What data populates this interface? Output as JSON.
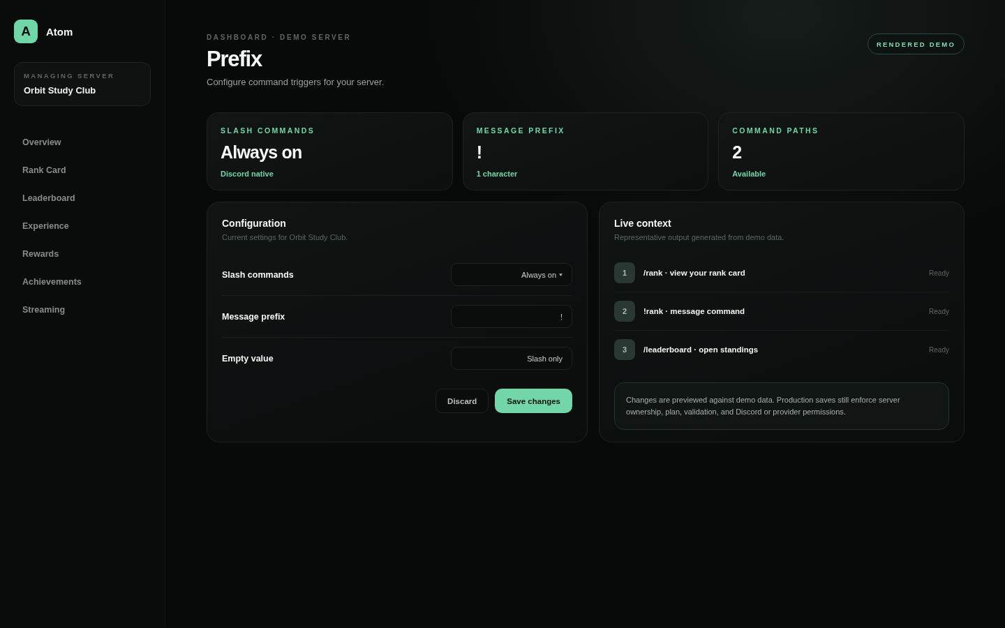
{
  "sidebar": {
    "logo": {
      "letter": "A",
      "name": "Atom"
    },
    "server_card": {
      "label": "MANAGING SERVER",
      "name": "Orbit Study Club"
    },
    "items": [
      {
        "label": "Overview",
        "selected": false
      },
      {
        "label": "Rank Card",
        "selected": false
      },
      {
        "label": "Leaderboard",
        "selected": false
      },
      {
        "label": "Experience",
        "selected": false
      },
      {
        "label": "Rewards",
        "selected": false
      },
      {
        "label": "Achievements",
        "selected": false
      },
      {
        "label": "Streaming",
        "selected": false
      }
    ]
  },
  "header": {
    "breadcrumb": "DASHBOARD · DEMO SERVER",
    "title": "Prefix",
    "subtitle": "Configure command triggers for your server.",
    "badge": "RENDERED DEMO"
  },
  "stats": [
    {
      "label": "SLASH COMMANDS",
      "value": "Always on",
      "note": "Discord native"
    },
    {
      "label": "MESSAGE PREFIX",
      "value": "!",
      "note": "1 character"
    },
    {
      "label": "COMMAND PATHS",
      "value": "2",
      "note": "Available"
    }
  ],
  "configuration": {
    "title": "Configuration",
    "subtitle": "Current settings for Orbit Study Club.",
    "fields": [
      {
        "label": "Slash commands",
        "kind": "select",
        "value": "Always on"
      },
      {
        "label": "Message prefix",
        "kind": "text",
        "value": "!"
      },
      {
        "label": "Empty value",
        "kind": "text",
        "value": "Slash only"
      }
    ],
    "buttons": [
      {
        "label": "Discard",
        "kind": "secondary"
      },
      {
        "label": "Save changes",
        "kind": "primary"
      }
    ]
  },
  "live_context": {
    "title": "Live context",
    "subtitle": "Representative output generated from demo data.",
    "items": [
      {
        "number": "1",
        "text": "/rank · view your rank card",
        "status": "Ready"
      },
      {
        "number": "2",
        "text": "!rank · message command",
        "status": "Ready"
      },
      {
        "number": "3",
        "text": "/leaderboard · open standings",
        "status": "Ready"
      }
    ],
    "note": "Changes are previewed against demo data. Production saves still enforce server ownership, plan, validation, and Discord or provider permissions."
  }
}
